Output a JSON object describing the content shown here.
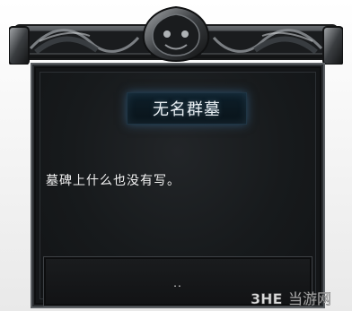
{
  "dialog": {
    "title": "无名群墓",
    "message": "墓碑上什么也没有写。",
    "choice": ".."
  },
  "watermark": {
    "text": "3HE 当游网"
  },
  "colors": {
    "panel_bg": "#141618",
    "title_glow": "#3c78aa",
    "text": "#f2f2f2"
  }
}
